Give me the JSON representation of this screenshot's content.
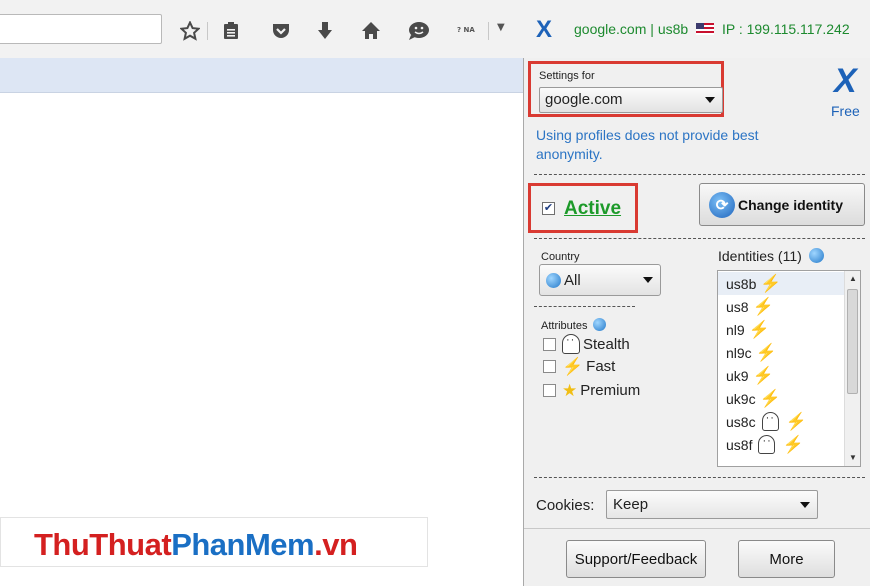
{
  "toolbar": {
    "url_value": "",
    "na_badge": "? NA",
    "status": {
      "domain": "google.com",
      "identity": "us8b",
      "ip": "IP : 199.115.117.242"
    }
  },
  "watermark": {
    "part1": "ThuThuat",
    "part2": "PhanMem",
    "part3": ".vn"
  },
  "panel": {
    "settings_label": "Settings for",
    "settings_value": "google.com",
    "logo_letter": "X",
    "free_label": "Free",
    "notice": "Using profiles does not provide best anonymity.",
    "active_label": "Active",
    "active_checked": true,
    "change_identity_label": "Change identity",
    "country_label": "Country",
    "country_value": "All",
    "attributes_label": "Attributes",
    "attributes": [
      {
        "label": "Stealth",
        "icon": "ghost-icon"
      },
      {
        "label": "Fast",
        "icon": "lightning-icon"
      },
      {
        "label": "Premium",
        "icon": "star-icon"
      }
    ],
    "identities_label": "Identities (11)",
    "identities": [
      {
        "name": "us8b",
        "icons": [
          "lightning-icon"
        ]
      },
      {
        "name": "us8",
        "icons": [
          "lightning-icon"
        ]
      },
      {
        "name": "nl9",
        "icons": [
          "lightning-icon"
        ]
      },
      {
        "name": "nl9c",
        "icons": [
          "lightning-icon"
        ]
      },
      {
        "name": "uk9",
        "icons": [
          "lightning-icon"
        ]
      },
      {
        "name": "uk9c",
        "icons": [
          "lightning-icon"
        ]
      },
      {
        "name": "us8c",
        "icons": [
          "ghost-icon",
          "lightning-icon"
        ]
      },
      {
        "name": "us8f",
        "icons": [
          "ghost-icon",
          "lightning-icon"
        ]
      }
    ],
    "cookies_label": "Cookies:",
    "cookies_value": "Keep",
    "support_label": "Support/Feedback",
    "more_label": "More"
  }
}
